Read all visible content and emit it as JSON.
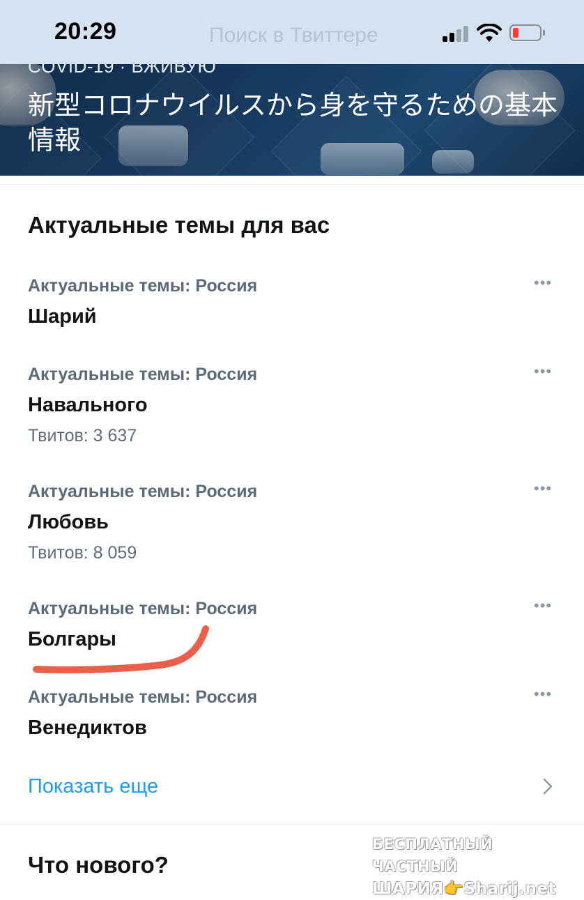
{
  "status_bar": {
    "time": "20:29",
    "ghost_text": "Поиск в Твиттере"
  },
  "banner": {
    "label": "COVID-19 · ВЖИВУЮ",
    "title": "新型コロナウイルスから身を守るための基本情報"
  },
  "trends": {
    "heading": "Актуальные темы для вас",
    "items": [
      {
        "context": "Актуальные темы: Россия",
        "name": "Шарий",
        "count": ""
      },
      {
        "context": "Актуальные темы: Россия",
        "name": "Навального",
        "count": "Твитов: 3 637"
      },
      {
        "context": "Актуальные темы: Россия",
        "name": "Любовь",
        "count": "Твитов: 8 059"
      },
      {
        "context": "Актуальные темы: Россия",
        "name": "Болгары",
        "count": ""
      },
      {
        "context": "Актуальные темы: Россия",
        "name": "Венедиктов",
        "count": ""
      }
    ],
    "more_icon": "•••",
    "show_more": "Показать еще"
  },
  "whats_new": {
    "heading": "Что нового?"
  },
  "watermark": {
    "line1": "БЕСПЛАТНЫЙ ЧАСТНЫЙ",
    "line2": "ШАРИЯ👉Sharij.net"
  },
  "colors": {
    "accent": "#1d9bf0",
    "muted_text": "#5b6b7a",
    "annotation": "#e8513a",
    "status_bar_bg": "#d6e2ef"
  }
}
